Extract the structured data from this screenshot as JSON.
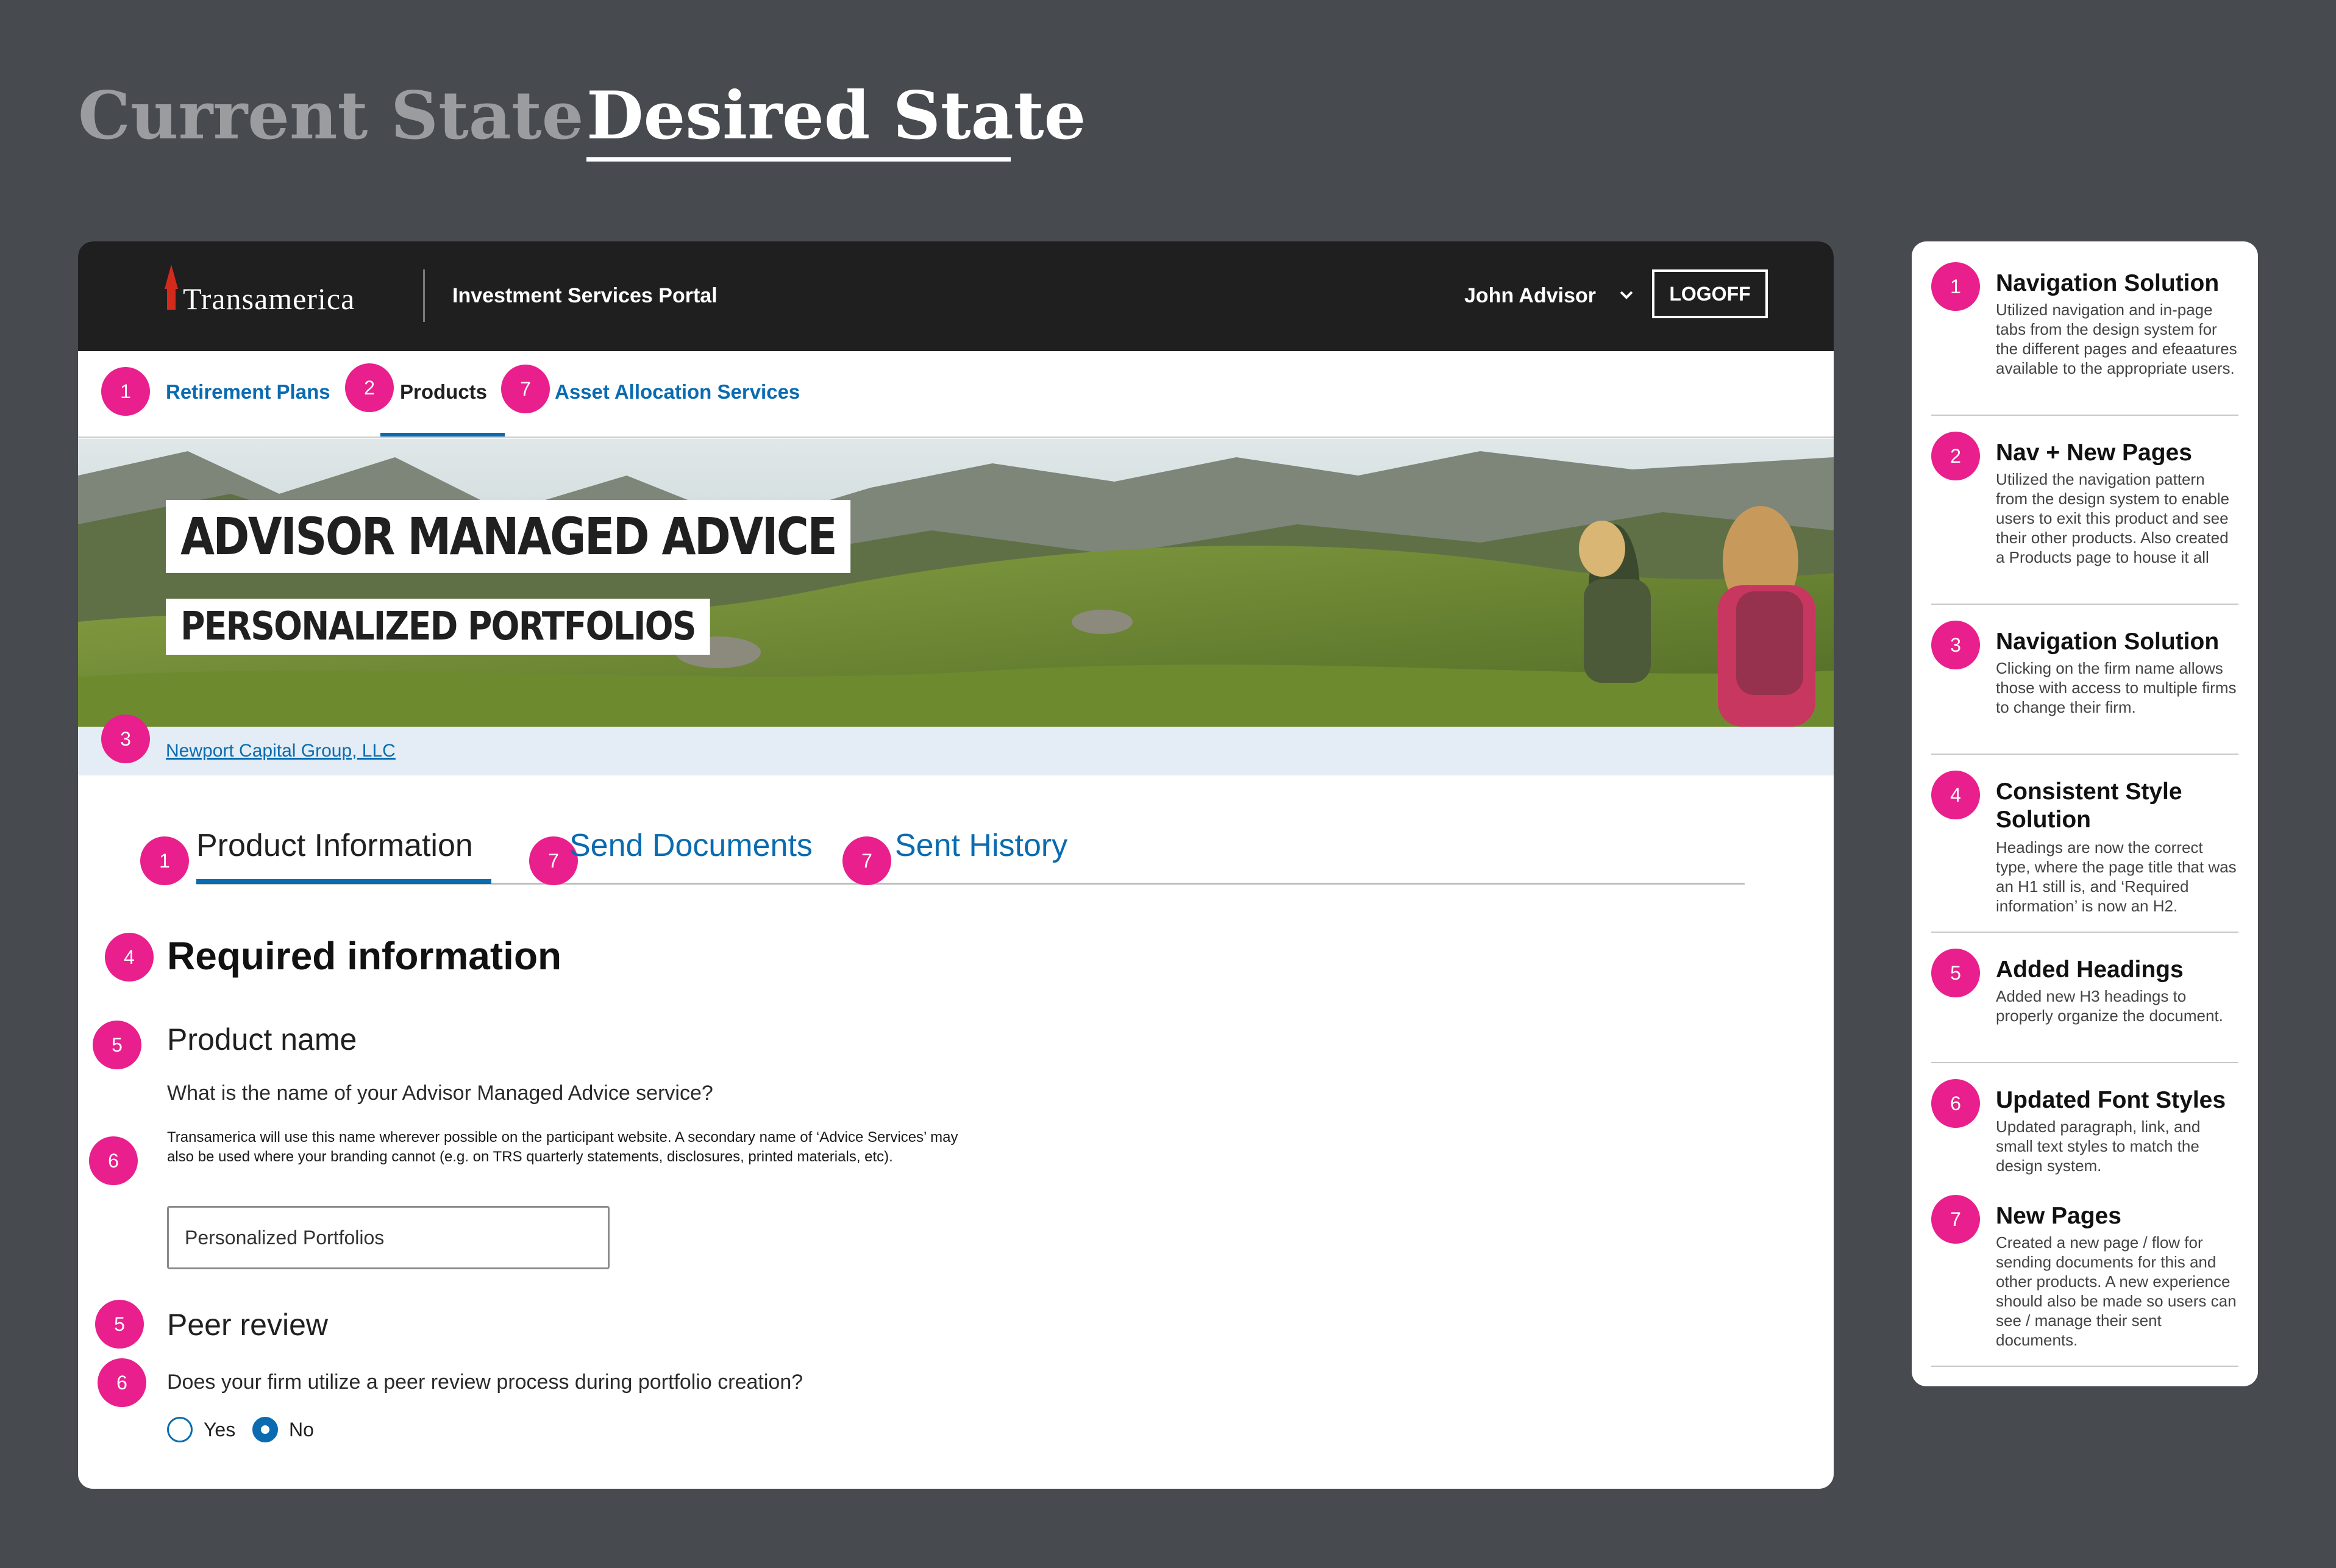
{
  "state_tabs": {
    "current": "Current State",
    "desired": "Desired State"
  },
  "header": {
    "logo_text": "Transamerica",
    "portal_title": "Investment Services Portal",
    "user_name": "John Advisor",
    "logoff_label": "LOGOFF"
  },
  "primary_nav": {
    "items": [
      {
        "label": "Retirement Plans",
        "badge": "1"
      },
      {
        "label": "Products",
        "badge": "2"
      },
      {
        "label": "Asset Allocation Services",
        "badge": "7"
      }
    ]
  },
  "hero": {
    "title": "ADVISOR MANAGED ADVICE",
    "subtitle": "PERSONALIZED PORTFOLIOS"
  },
  "firm": {
    "name": "Newport Capital Group, LLC",
    "badge": "3"
  },
  "tabs": {
    "items": [
      {
        "label": "Product Information",
        "badge": "1"
      },
      {
        "label": "Send Documents",
        "badge": "7"
      },
      {
        "label": "Sent History",
        "badge": "7"
      }
    ]
  },
  "form": {
    "heading": "Required information",
    "heading_badge": "4",
    "product_name": {
      "heading": "Product name",
      "heading_badge": "5",
      "question": "What is the name of your Advisor Managed Advice service?",
      "help_text": "Transamerica will use this name wherever possible on the participant website.  A secondary name of ‘Advice Services’ may also be used where your branding cannot (e.g. on TRS quarterly statements, disclosures, printed materials, etc).",
      "help_badge": "6",
      "value": "Personalized Portfolios"
    },
    "peer_review": {
      "heading": "Peer review",
      "heading_badge": "5",
      "question": "Does your firm utilize a peer review process during portfolio creation?",
      "question_badge": "6",
      "options": [
        "Yes",
        "No"
      ],
      "selected": "No"
    }
  },
  "annotations": [
    {
      "number": "1",
      "title": "Navigation Solution",
      "body": "Utilized navigation and in-page tabs from the design system for the different pages and efeaatures available to the appropriate users."
    },
    {
      "number": "2",
      "title": "Nav + New Pages",
      "body": "Utilized the navigation pattern from the design system to enable users to exit this product and see their other products. Also created a Products page to house it all"
    },
    {
      "number": "3",
      "title": "Navigation Solution",
      "body": "Clicking on the firm name allows those with access to multiple firms to change their firm."
    },
    {
      "number": "4",
      "title": "Consistent Style Solution",
      "body": "Headings are now the correct type, where the page title that was an H1 still is, and ‘Required information’ is now an H2."
    },
    {
      "number": "5",
      "title": "Added Headings",
      "body": "Added new H3 headings to properly organize the document."
    },
    {
      "number": "6",
      "title": "Updated Font Styles",
      "body": "Updated paragraph, link, and small text styles to match the design system."
    },
    {
      "number": "7",
      "title": "New Pages",
      "body": "Created a new page / flow for sending documents for this and other products. A new experience should also be made so users can see / manage their sent documents."
    }
  ],
  "colors": {
    "background": "#474a4f",
    "header": "#1f1f1f",
    "link_blue": "#0a6bb0",
    "annotation_pink": "#e81f8c",
    "firm_bar": "#e4edf5",
    "logo_red": "#d42a1c"
  }
}
